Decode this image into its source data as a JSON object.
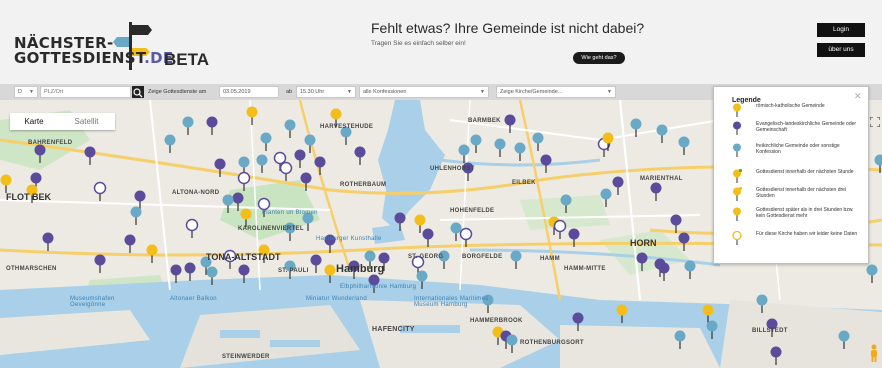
{
  "header": {
    "logo_line1": "NÄCHSTER-",
    "logo_line2": "GOTTESDIENST",
    "logo_tld": ".DE",
    "beta": "BETA",
    "headline": "Fehlt etwas? Ihre Gemeinde ist nicht dabei?",
    "subline": "Tragen Sie es einfach selber ein!",
    "why_button": "Wie geht das?",
    "login_button": "Login",
    "about_button": "über uns"
  },
  "filters": {
    "country": "D",
    "location_placeholder": "PLZ/Ort",
    "show_services_label": "Zeige Gottesdienste am",
    "date": "03.05.2019",
    "at_label": "ab",
    "time": "15.30 Uhr",
    "denomination": "alle Konfessionen",
    "church_select": "Zeige Kirche/Gemeinde..."
  },
  "map": {
    "type_tabs": [
      "Karte",
      "Satellit"
    ],
    "labels": {
      "bahrenfeld": "BAHRENFELD",
      "hafvestehude": "HARVESTEHUDE",
      "barmbek": "BARMBEK",
      "altona_nord": "ALTONA-NORD",
      "rotherbaum": "ROTHERBAUM",
      "uhlenhorst": "UHLENHORST",
      "eilbek": "EILBEK",
      "marienthal": "MARIENTHAL",
      "hohenfelde": "HOHENFELDE",
      "ottensen_flot": "FLOT BEK",
      "karolinenviertel": "KAROLINENVIERTEL",
      "st_georg": "ST. GEORG",
      "borgfelde": "BORGFELDE",
      "hamm": "HAMM",
      "hamm_mitte": "HAMM-MITTE",
      "horn": "HORN",
      "othmarschen": "OTHMARSCHEN",
      "altona_altstadt": "TONA-ALTSTADT",
      "st_pauli": "ST. PAULI",
      "hamburg": "Hamburg",
      "hafencity": "HAFENCITY",
      "hammerbrook": "HAMMERBROOK",
      "rothenburgsort": "ROTHENBURGSORT",
      "billstedt": "BILLSTEDT",
      "steinwerder": "STEINWERDER",
      "museumshafen": "Museumshafen Oevelgönne",
      "altonaer_balkon": "Altonaer Balkon",
      "miniatur": "Miniatur Wunderland",
      "planten": "Planten un Blomen",
      "hagenbeck": "Hamburger Kunsthalle",
      "elbphilharmonie": "Elbphilharmonie Hamburg",
      "maritimes": "Internationales Maritimes Museum Hamburg"
    }
  },
  "legend": {
    "title": "Legende",
    "items": [
      {
        "text": "römisch-katholische Gemeinde",
        "color": "#f3bd1a"
      },
      {
        "text": "Evangelisch-landeskirchliche Gemeinde oder Gemeinschaft",
        "color": "#5a4b9b"
      },
      {
        "text": "freikirchliche Gemeinde oder sonstige Konfession",
        "color": "#6aa9c6"
      },
      {
        "text": "Gottesdienst innerhalb der nächsten Stunde",
        "color": "#f3bd1a"
      },
      {
        "text": "Gottesdienst innerhalb der nächsten drei Stunden",
        "color": "#f3bd1a"
      },
      {
        "text": "Gottesdienst später als in drei Stunden bzw. kein Gottesdienst mehr",
        "color": "#f3bd1a"
      },
      {
        "text": "Für diese Kirche haben wir leider keine Daten",
        "color": "#f3bd1a"
      }
    ]
  },
  "colors": {
    "catholic": "#f3bd1a",
    "protestant": "#5a4b9b",
    "free": "#6aa9c6",
    "water": "#a9d0e8",
    "park": "#c8e4c0"
  },
  "icons": [
    "search-icon",
    "fullscreen-icon",
    "pegman-icon",
    "close-icon",
    "map-pin-icon"
  ]
}
